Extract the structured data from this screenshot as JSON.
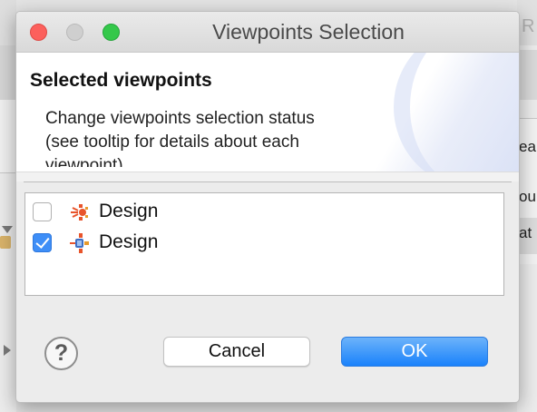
{
  "background_app": {
    "right_letter": "R",
    "right_fragments": [
      "ea",
      "ou",
      "at"
    ]
  },
  "dialog": {
    "title": "Viewpoints Selection",
    "header": {
      "title": "Selected viewpoints",
      "description": "Change viewpoints selection status (see tooltip for details about each viewpoint)"
    },
    "viewpoints": [
      {
        "label": "Design",
        "checked": false,
        "icon": "design-viewpoint-icon"
      },
      {
        "label": "Design",
        "checked": true,
        "icon": "design-viewpoint-icon"
      }
    ],
    "buttons": {
      "help": "?",
      "cancel": "Cancel",
      "ok": "OK"
    }
  },
  "colors": {
    "ok_button": "#1a82fb",
    "checkbox_checked": "#3e8ef7",
    "close": "#fc605c",
    "maximize": "#34c84a",
    "icon_red": "#e8542b",
    "icon_blue": "#3f6fc4",
    "icon_orange": "#e89a2b"
  }
}
